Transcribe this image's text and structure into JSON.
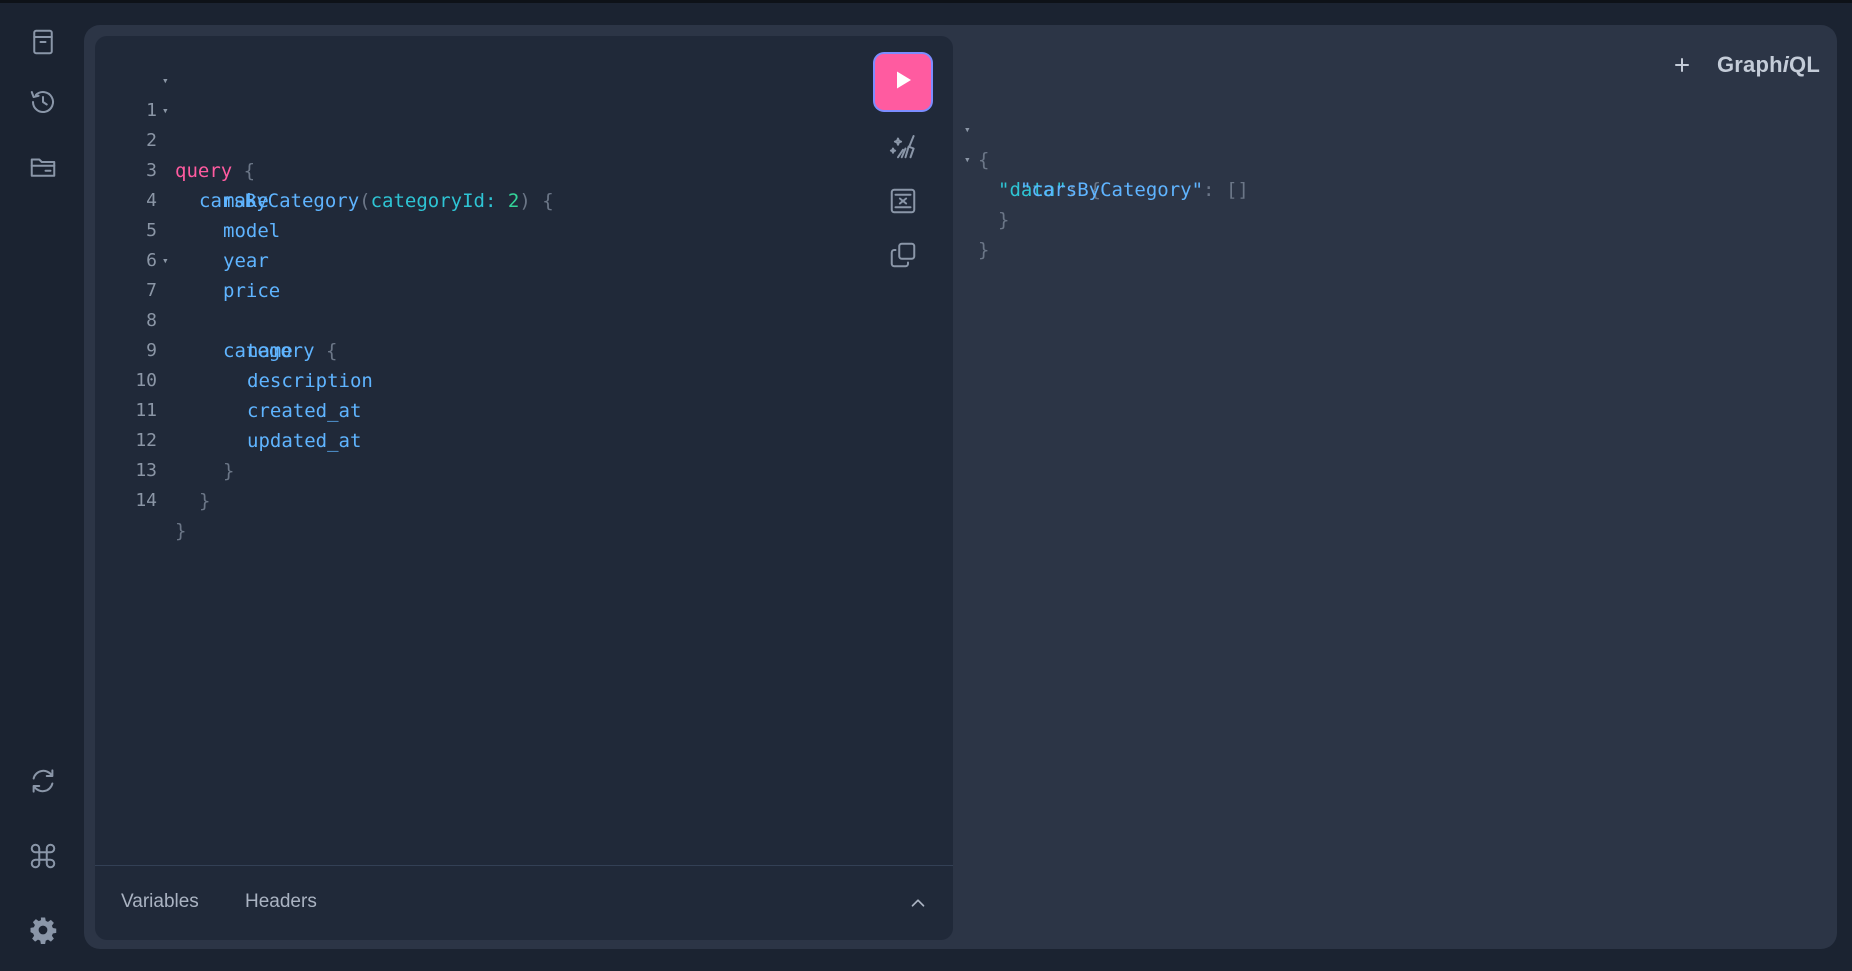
{
  "app": {
    "title_prefix": "Graph",
    "title_italic": "i",
    "title_suffix": "QL"
  },
  "sidebar": {
    "top_icons": [
      "docs-icon",
      "history-icon",
      "explorer-icon"
    ],
    "bottom_icons": [
      "refresh-icon",
      "shortcut-icon",
      "settings-icon"
    ]
  },
  "editor": {
    "lines": [
      {
        "n": "1",
        "fold": true
      },
      {
        "n": "2",
        "fold": true
      },
      {
        "n": "3",
        "fold": false
      },
      {
        "n": "4",
        "fold": false
      },
      {
        "n": "5",
        "fold": false
      },
      {
        "n": "6",
        "fold": false
      },
      {
        "n": "7",
        "fold": true
      },
      {
        "n": "8",
        "fold": false
      },
      {
        "n": "9",
        "fold": false
      },
      {
        "n": "10",
        "fold": false
      },
      {
        "n": "11",
        "fold": false
      },
      {
        "n": "12",
        "fold": false
      },
      {
        "n": "13",
        "fold": false
      },
      {
        "n": "14",
        "fold": false
      }
    ],
    "tokens": {
      "query_kw": "query",
      "open_brace": "{",
      "close_brace": "}",
      "root_field": "carsByCategory",
      "paren_open": "(",
      "paren_close": ")",
      "arg_name": "categoryId",
      "colon": ":",
      "arg_value": "2",
      "f_make": "make",
      "f_model": "model",
      "f_year": "year",
      "f_price": "price",
      "f_category": "category",
      "f_name": "name",
      "f_description": "description",
      "f_created": "created_at",
      "f_updated": "updated_at"
    },
    "footer": {
      "variables_tab": "Variables",
      "headers_tab": "Headers"
    }
  },
  "result": {
    "open": "{",
    "data_key": "\"data\"",
    "colon": ":",
    "inner_open": "{",
    "cars_key": "\"carsByCategory\"",
    "cars_value": "[]",
    "inner_close": "}",
    "close": "}"
  },
  "colors": {
    "run_button": "#ff5ba0",
    "keyword": "#ff5ba0",
    "field": "#5fb4ff",
    "argument": "#2ec4d4",
    "number": "#34d399"
  }
}
